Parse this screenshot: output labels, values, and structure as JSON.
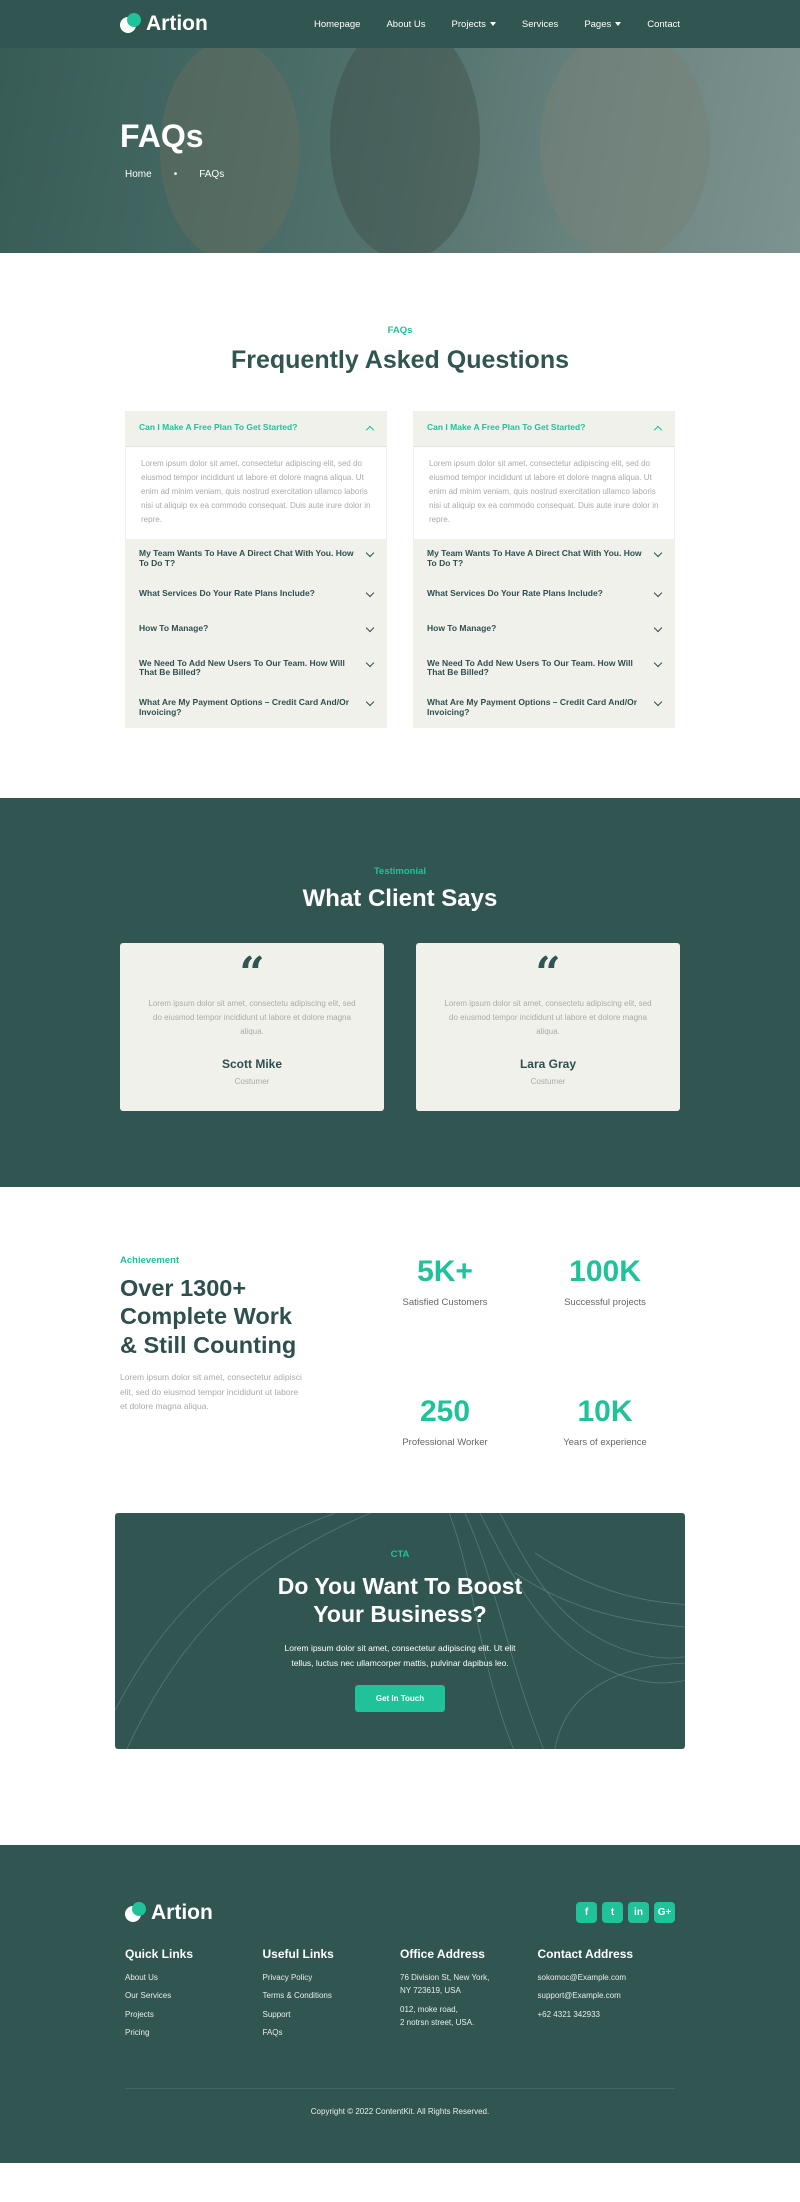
{
  "brand": {
    "name": "Artion"
  },
  "nav": {
    "items": [
      {
        "label": "Homepage"
      },
      {
        "label": "About Us"
      },
      {
        "label": "Projects"
      },
      {
        "label": "Services"
      },
      {
        "label": "Pages"
      },
      {
        "label": "Contact"
      }
    ]
  },
  "hero": {
    "title": "FAQs",
    "crumb_home": "Home",
    "crumb_sep": "•",
    "crumb_current": "FAQs"
  },
  "faq": {
    "eyebrow": "FAQs",
    "title": "Frequently Asked Questions",
    "answer": "Lorem ipsum dolor sit amet, consectetur adipiscing elit, sed do eiusmod tempor incididunt ut labore et dolore magna aliqua. Ut enim ad minim veniam, quis nostrud exercitation ullamco laboris nisi ut aliquip ex ea commodo consequat. Duis aute irure dolor in repre.",
    "questions": [
      "Can I Make A Free Plan To Get Started?",
      "My Team Wants To Have A Direct Chat With You. How To Do T?",
      "What Services Do Your Rate Plans Include?",
      "How To Manage?",
      "We Need To Add New Users To Our Team. How Will That Be Billed?",
      "What Are My Payment Options – Credit Card And/Or Invoicing?"
    ]
  },
  "testimonial": {
    "eyebrow": "Testimonial",
    "title": "What Client Says",
    "quote_glyph": "“",
    "cards": [
      {
        "text": "Lorem ipsum dolor sit amet, consectetu adipiscing elit, sed do eiusmod tempor incididunt ut labore et dolore magna aliqua.",
        "name": "Scott Mike",
        "role": "Costumer"
      },
      {
        "text": "Lorem ipsum dolor sit amet, consectetu adipiscing elit, sed do eiusmod tempor incididunt ut labore et dolore magna aliqua.",
        "name": "Lara Gray",
        "role": "Costumer"
      }
    ]
  },
  "achievement": {
    "eyebrow": "Achievement",
    "title": "Over 1300+ Complete Work & Still Counting",
    "text": "Lorem ipsum dolor sit amet, consectetur adipisci elit, sed do eiusmod tempor incididunt ut labore et dolore magna aliqua.",
    "stats": [
      {
        "value": "5K+",
        "label": "Satisfied Customers"
      },
      {
        "value": "100K",
        "label": "Successful projects"
      },
      {
        "value": "250",
        "label": "Professional Worker"
      },
      {
        "value": "10K",
        "label": "Years of experience"
      }
    ]
  },
  "cta": {
    "eyebrow": "CTA",
    "title_line1": "Do You Want To Boost",
    "title_line2": "Your Business?",
    "text_line1": "Lorem ipsum dolor sit amet, consectetur adipiscing elit. Ut elit",
    "text_line2": "tellus, luctus nec ullamcorper mattis, pulvinar dapibus leo.",
    "button": "Get In Touch"
  },
  "footer": {
    "socials": [
      {
        "icon": "facebook-icon",
        "glyph": "f"
      },
      {
        "icon": "twitter-icon",
        "glyph": "t"
      },
      {
        "icon": "linkedin-icon",
        "glyph": "in"
      },
      {
        "icon": "google-plus-icon",
        "glyph": "G+"
      }
    ],
    "quick": {
      "title": "Quick Links",
      "items": [
        "About Us",
        "Our Services",
        "Projects",
        "Pricing"
      ]
    },
    "useful": {
      "title": "Useful Links",
      "items": [
        "Privacy Policy",
        "Terms & Conditions",
        "Support",
        "FAQs"
      ]
    },
    "office": {
      "title": "Office Address",
      "line1": "76 Division St, New York,",
      "line2": "NY 723619, USA",
      "line3": "012, moke road,",
      "line4": "2 notrsn street, USA."
    },
    "contact": {
      "title": "Contact Address",
      "items": [
        "sokomoc@Example.com",
        "support@Example.com",
        "+62 4321 342933"
      ]
    },
    "copyright": "Copyright © 2022 ContentKit. All Rights Reserved."
  },
  "colors": {
    "primary_dark": "#315551",
    "accent": "#20c29a",
    "light_bg": "#f1f1ec"
  }
}
